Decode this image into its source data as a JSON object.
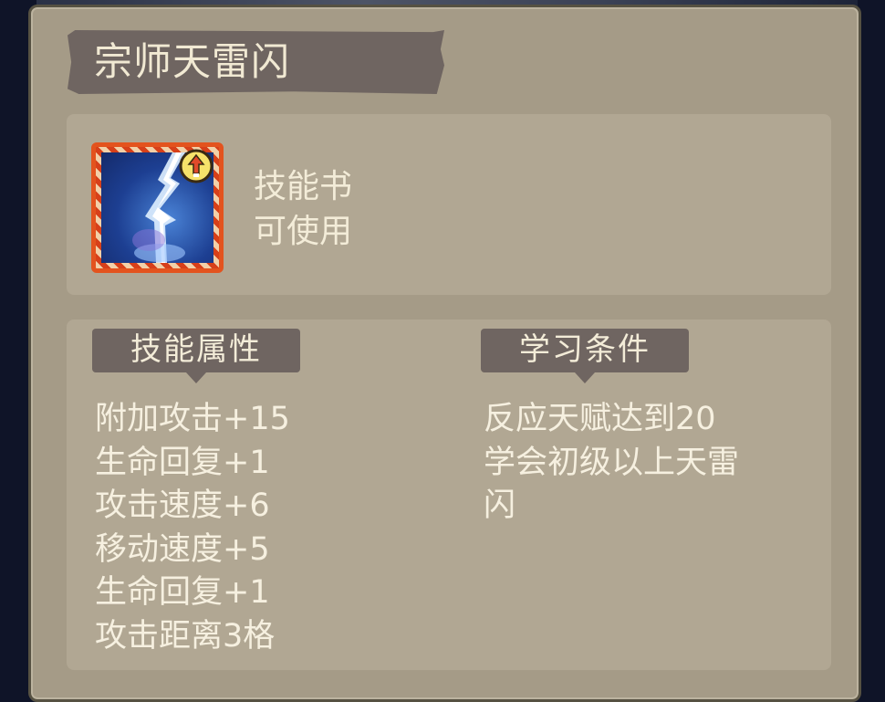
{
  "item": {
    "name": "宗师天雷闪",
    "type": "技能书",
    "status": "可使用",
    "icon": "lightning-skill-icon",
    "badge_icon": "upgrade-badge-icon"
  },
  "sections": {
    "attributes_title": "技能属性",
    "requirements_title": "学习条件"
  },
  "attributes": [
    "附加攻击+15",
    "生命回复+1",
    "攻击速度+6",
    "移动速度+5",
    "生命回复+1",
    "攻击距离3格"
  ],
  "requirements": [
    "反应天赋达到20",
    "学会初级以上天雷",
    "闪"
  ],
  "colors": {
    "panel_bg": "#a59b87",
    "inner_box": "#b1a793",
    "tag_bg": "#6f6561",
    "text": "#f3ecd8",
    "icon_border": "#e3531e"
  }
}
